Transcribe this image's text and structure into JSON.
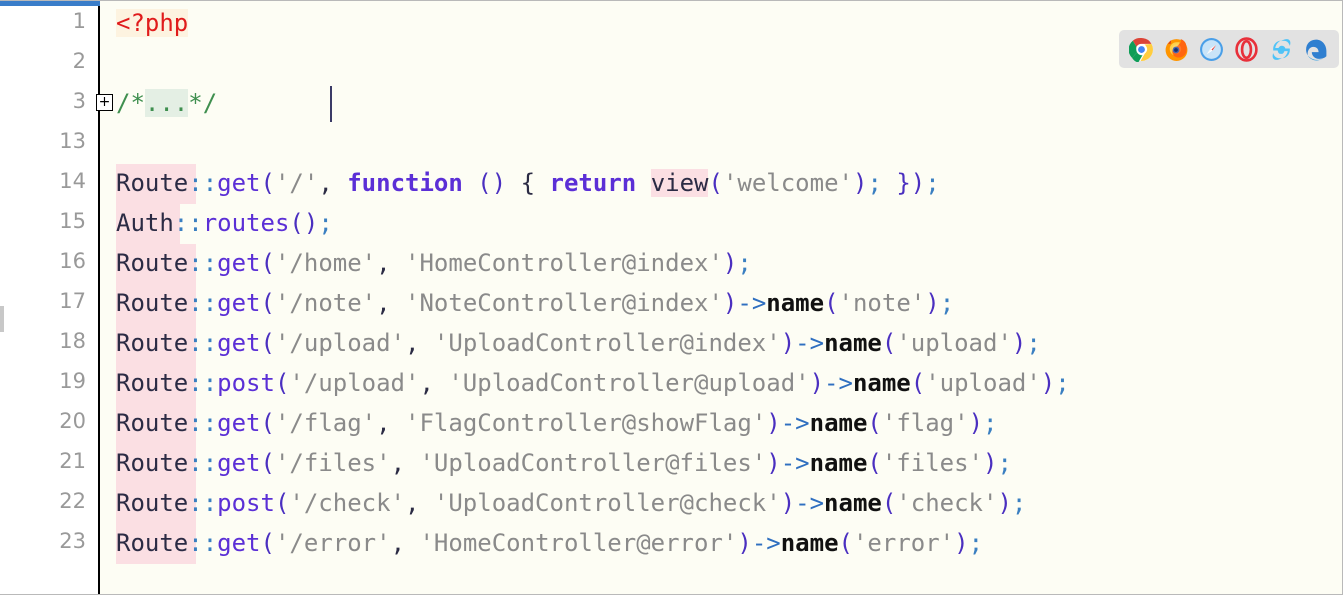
{
  "editor": {
    "language": "php",
    "background": "#fdfdf4",
    "gutter_background": "#ffffff",
    "accent_color": "#3a7dc9",
    "class_highlight_color": "#fbdfe3",
    "fold_marker_label": "+"
  },
  "gutter": {
    "line_numbers": [
      "1",
      "2",
      "3",
      "13",
      "14",
      "15",
      "16",
      "17",
      "18",
      "19",
      "20",
      "21",
      "22",
      "23"
    ]
  },
  "code": {
    "line1": {
      "open_tag": "<?php"
    },
    "line3": {
      "comment_open": "/*",
      "folded_placeholder": "...",
      "comment_close": "*/"
    },
    "line14": {
      "cls": "Route",
      "sep": "::",
      "method": "get",
      "paren_open": "(",
      "arg1": "'/'",
      "comma": ", ",
      "keyword_function": "function",
      "fn_parens": " () ",
      "brace_open": "{ ",
      "keyword_return": "return",
      "space": " ",
      "view_fn": "view",
      "view_open": "(",
      "view_arg": "'welcome'",
      "view_close": ")",
      "semi1": "; ",
      "brace_close": "}",
      "paren_close": ")",
      "semi2": ";"
    },
    "line15": {
      "cls": "Auth",
      "sep": "::",
      "method": "routes",
      "parens": "()",
      "semi": ";"
    },
    "line16": {
      "cls": "Route",
      "sep": "::",
      "method": "get",
      "paren_open": "(",
      "arg1": "'/home'",
      "comma": ", ",
      "arg2": "'HomeController@index'",
      "paren_close": ")",
      "semi": ";"
    },
    "line17": {
      "cls": "Route",
      "sep": "::",
      "method": "get",
      "paren_open": "(",
      "arg1": "'/note'",
      "comma": ", ",
      "arg2": "'NoteController@index'",
      "paren_close": ")",
      "arrow": "->",
      "name_fn": "name",
      "name_open": "(",
      "name_arg": "'note'",
      "name_close": ")",
      "semi": ";"
    },
    "line18": {
      "cls": "Route",
      "sep": "::",
      "method": "get",
      "paren_open": "(",
      "arg1": "'/upload'",
      "comma": ", ",
      "arg2": "'UploadController@index'",
      "paren_close": ")",
      "arrow": "->",
      "name_fn": "name",
      "name_open": "(",
      "name_arg": "'upload'",
      "name_close": ")",
      "semi": ";"
    },
    "line19": {
      "cls": "Route",
      "sep": "::",
      "method": "post",
      "paren_open": "(",
      "arg1": "'/upload'",
      "comma": ", ",
      "arg2": "'UploadController@upload'",
      "paren_close": ")",
      "arrow": "->",
      "name_fn": "name",
      "name_open": "(",
      "name_arg": "'upload'",
      "name_close": ")",
      "semi": ";"
    },
    "line20": {
      "cls": "Route",
      "sep": "::",
      "method": "get",
      "paren_open": "(",
      "arg1": "'/flag'",
      "comma": ", ",
      "arg2": "'FlagController@showFlag'",
      "paren_close": ")",
      "arrow": "->",
      "name_fn": "name",
      "name_open": "(",
      "name_arg": "'flag'",
      "name_close": ")",
      "semi": ";"
    },
    "line21": {
      "cls": "Route",
      "sep": "::",
      "method": "get",
      "paren_open": "(",
      "arg1": "'/files'",
      "comma": ", ",
      "arg2": "'UploadController@files'",
      "paren_close": ")",
      "arrow": "->",
      "name_fn": "name",
      "name_open": "(",
      "name_arg": "'files'",
      "name_close": ")",
      "semi": ";"
    },
    "line22": {
      "cls": "Route",
      "sep": "::",
      "method": "post",
      "paren_open": "(",
      "arg1": "'/check'",
      "comma": ", ",
      "arg2": "'UploadController@check'",
      "paren_close": ")",
      "arrow": "->",
      "name_fn": "name",
      "name_open": "(",
      "name_arg": "'check'",
      "name_close": ")",
      "semi": ";"
    },
    "line23": {
      "cls": "Route",
      "sep": "::",
      "method": "get",
      "paren_open": "(",
      "arg1": "'/error'",
      "comma": ", ",
      "arg2": "'HomeController@error'",
      "paren_close": ")",
      "arrow": "->",
      "name_fn": "name",
      "name_open": "(",
      "name_arg": "'error'",
      "name_close": ")",
      "semi": ";"
    }
  },
  "browser_bar": {
    "background": "#e2e2e2",
    "browsers": [
      {
        "icon": "chrome-icon",
        "label": "Chrome",
        "color": "#4285f4"
      },
      {
        "icon": "firefox-icon",
        "label": "Firefox",
        "color": "#ff9500"
      },
      {
        "icon": "safari-icon",
        "label": "Safari",
        "color": "#4a9fe8"
      },
      {
        "icon": "opera-icon",
        "label": "Opera",
        "color": "#e8303a"
      },
      {
        "icon": "ie-icon",
        "label": "Internet Explorer",
        "color": "#4fc3f7"
      },
      {
        "icon": "edge-icon",
        "label": "Edge",
        "color": "#2f7fd0"
      }
    ]
  }
}
